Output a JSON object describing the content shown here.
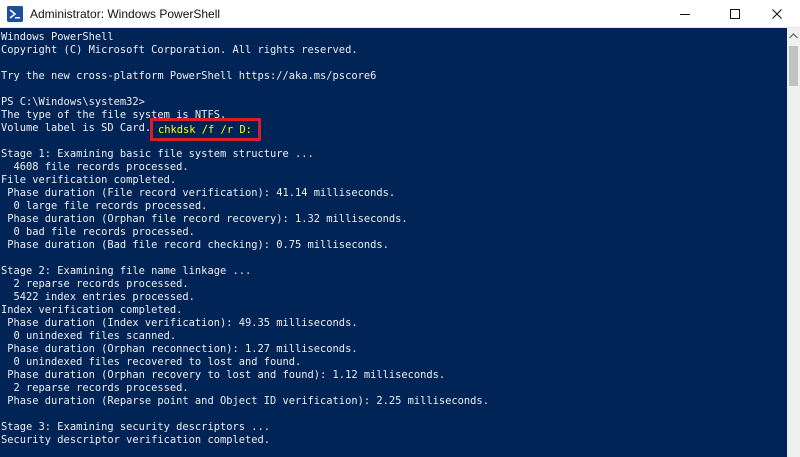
{
  "window": {
    "title": "Administrator: Windows PowerShell",
    "icon": "powershell-icon",
    "controls": [
      "minimize-icon",
      "maximize-icon",
      "close-icon"
    ]
  },
  "colors": {
    "console_background": "#012456",
    "console_text": "#eeedf0",
    "command_text": "#ffff00",
    "highlight_border": "#d81e2c"
  },
  "console": {
    "prompt": "PS C:\\Windows\\system32>",
    "command": "chkdsk /f /r D:",
    "lines": [
      "Windows PowerShell",
      "Copyright (C) Microsoft Corporation. All rights reserved.",
      "",
      "Try the new cross-platform PowerShell https://aka.ms/pscore6",
      "",
      "__PROMPT__",
      "The type of the file system is NTFS.",
      "Volume label is SD Card.",
      "",
      "Stage 1: Examining basic file system structure ...",
      "  4608 file records processed.",
      "File verification completed.",
      " Phase duration (File record verification): 41.14 milliseconds.",
      "  0 large file records processed.",
      " Phase duration (Orphan file record recovery): 1.32 milliseconds.",
      "  0 bad file records processed.",
      " Phase duration (Bad file record checking): 0.75 milliseconds.",
      "",
      "Stage 2: Examining file name linkage ...",
      "  2 reparse records processed.",
      "  5422 index entries processed.",
      "Index verification completed.",
      " Phase duration (Index verification): 49.35 milliseconds.",
      "  0 unindexed files scanned.",
      " Phase duration (Orphan reconnection): 1.27 milliseconds.",
      "  0 unindexed files recovered to lost and found.",
      " Phase duration (Orphan recovery to lost and found): 1.12 milliseconds.",
      "  2 reparse records processed.",
      " Phase duration (Reparse point and Object ID verification): 2.25 milliseconds.",
      "",
      "Stage 3: Examining security descriptors ...",
      "Security descriptor verification completed."
    ]
  }
}
